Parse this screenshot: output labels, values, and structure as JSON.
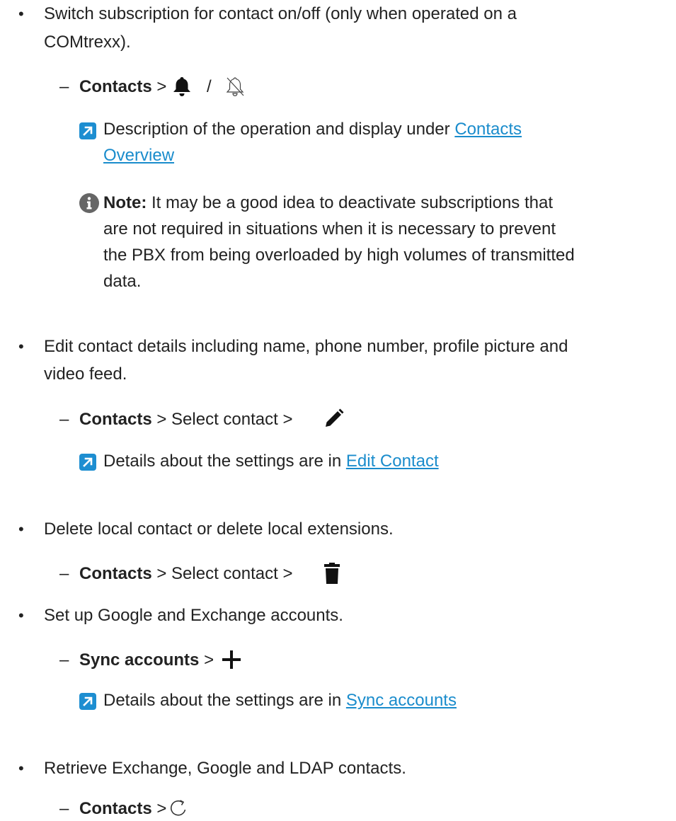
{
  "items": [
    {
      "text_line1": "Switch subscription for contact on/off (only when operated on a",
      "text_line2": "COMtrexx).",
      "path": {
        "bold": "Contacts",
        "sep1": " > ",
        "sep2": " / "
      },
      "ref": {
        "text_before": "Description of the operation and display under ",
        "link_line1": "Contacts",
        "link_line2": "Overview"
      },
      "note": {
        "label": "Note:",
        "line1": " It may be a good idea to deactivate subscriptions that",
        "line2": "are not required in situations when it is necessary to prevent",
        "line3": "the PBX from being overloaded by high volumes of transmitted",
        "line4": "data."
      }
    },
    {
      "text_line1": "Edit contact details including name, phone number, profile picture and",
      "text_line2": "video feed.",
      "path": {
        "bold": "Contacts",
        "rest": " > Select contact > "
      },
      "ref": {
        "text_before": "Details about the settings are in ",
        "link": "Edit Contact"
      }
    },
    {
      "text_line1": "Delete local contact or delete local extensions.",
      "path": {
        "bold": "Contacts",
        "rest": " > Select contact > "
      }
    },
    {
      "text_line1": "Set up Google and Exchange accounts.",
      "path": {
        "bold": "Sync accounts",
        "rest": " > "
      },
      "ref": {
        "text_before": "Details about the settings are in ",
        "link": "Sync accounts"
      }
    },
    {
      "text_line1": "Retrieve Exchange, Google and LDAP contacts.",
      "path": {
        "bold": "Contacts",
        "rest": " > "
      }
    }
  ],
  "symbols": {
    "bullet": "•",
    "dash": "–"
  },
  "icons": {
    "bell": "bell-icon",
    "bell_off": "bell-off-icon",
    "pencil": "pencil-icon",
    "trash": "trash-icon",
    "plus": "plus-icon",
    "refresh": "refresh-icon",
    "crossref": "arrow-link-icon",
    "note": "info-icon"
  },
  "colors": {
    "link": "#1a8ccc",
    "crossref_badge": "#1d8ed1",
    "info_icon": "#666666",
    "text": "#222222"
  }
}
